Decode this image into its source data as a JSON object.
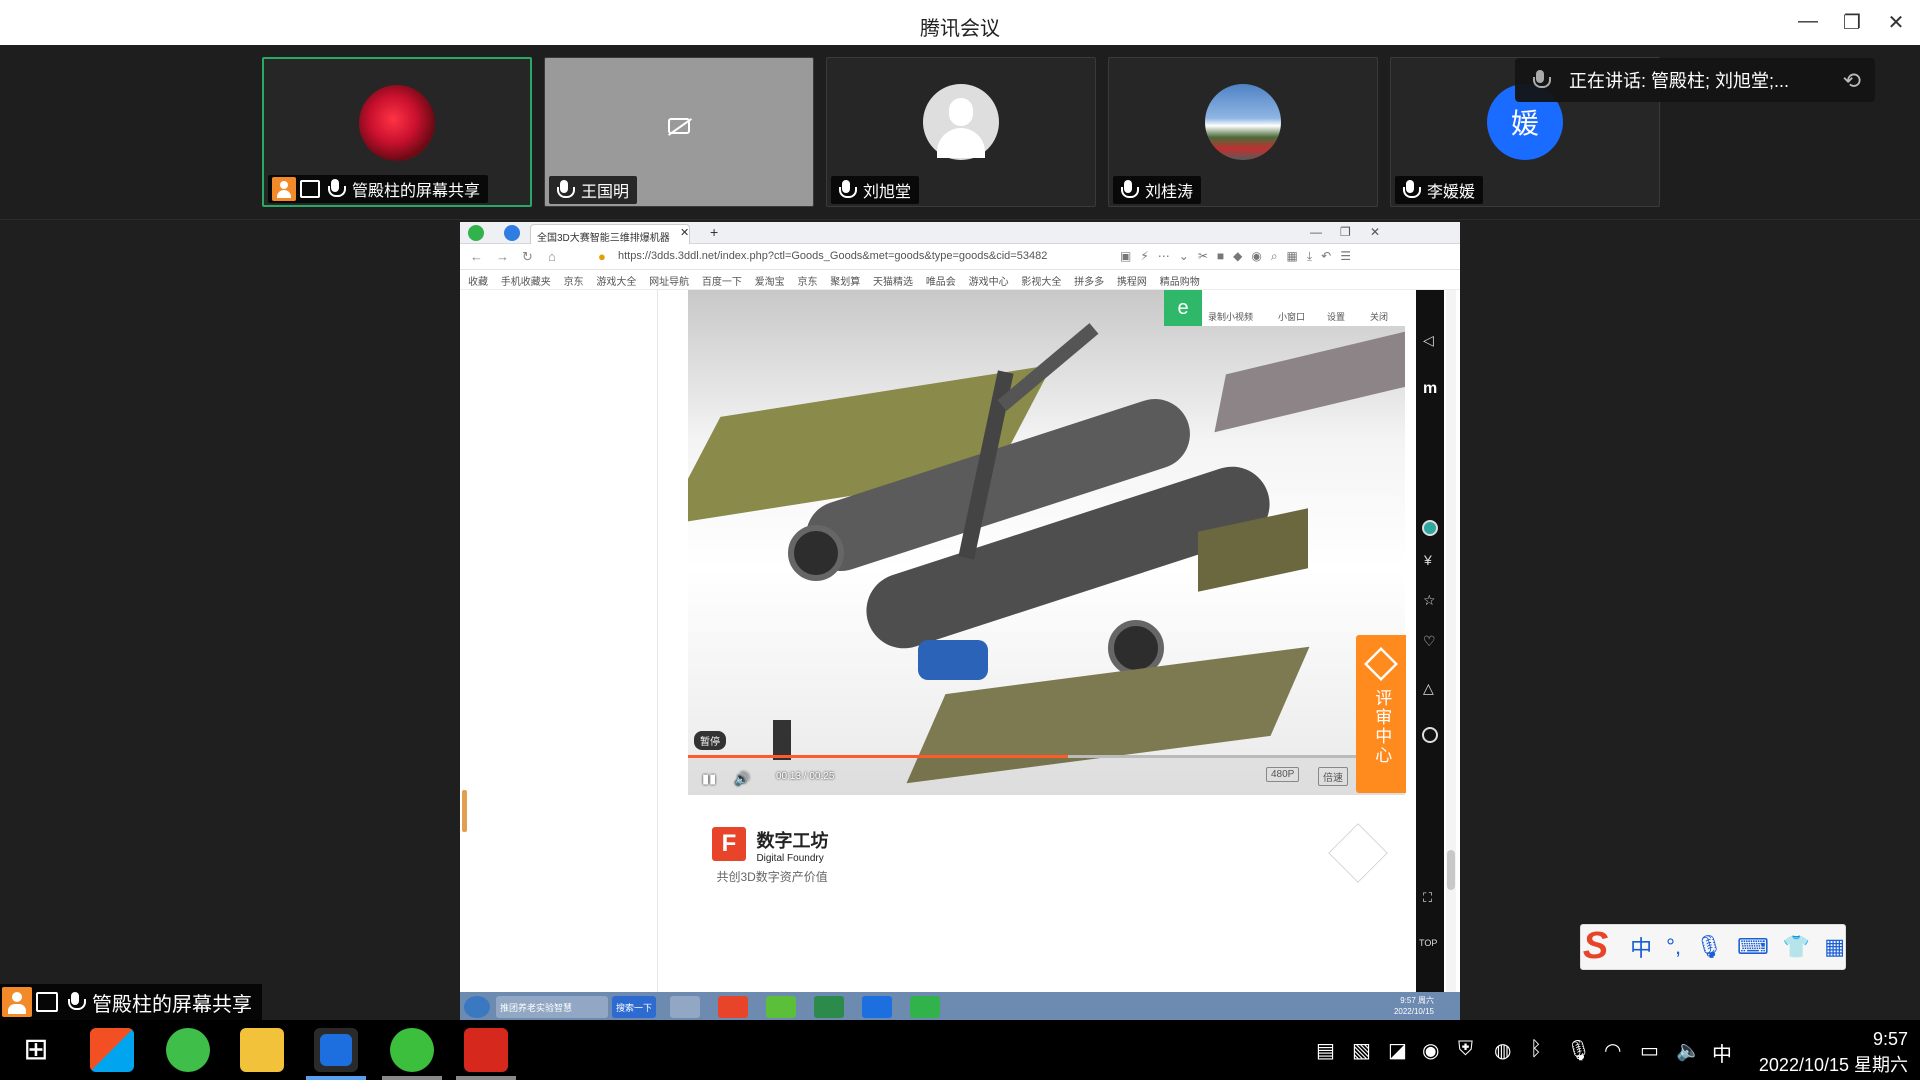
{
  "app": {
    "title": "腾讯会议"
  },
  "participants": [
    {
      "name": "管殿柱的屏幕共享",
      "active": true
    },
    {
      "name": "王国明",
      "camera_off": true
    },
    {
      "name": "刘旭堂"
    },
    {
      "name": "刘桂涛"
    },
    {
      "name": "李媛媛",
      "avatar_letter": "媛"
    }
  ],
  "speaking_banner": {
    "text": "正在讲话: 管殿柱; 刘旭堂;..."
  },
  "browser": {
    "tab_title": "全国3D大赛智能三维排爆机器",
    "url": "https://3dds.3ddl.net/index.php?ctl=Goods_Goods&met=goods&type=goods&cid=53482",
    "bookmarks": [
      "收藏",
      "手机收藏夹",
      "京东",
      "游戏大全",
      "网址导航",
      "百度一下",
      "爱淘宝",
      "京东",
      "聚划算",
      "天猫精选",
      "唯品会",
      "游戏中心",
      "影视大全",
      "拼多多",
      "携程网",
      "精品购物"
    ]
  },
  "video": {
    "toolbar": {
      "record": "录制小视频",
      "mini": "小窗口",
      "settings": "设置",
      "close": "关闭"
    },
    "pause_tip": "暂停",
    "time": "00:13 / 00:25",
    "progress": 0.53,
    "quality": "480P",
    "speed": "倍速"
  },
  "review_center": {
    "label": "评审中心"
  },
  "brand": {
    "logo_letter": "F",
    "name_cn": "数字工坊",
    "name_en": "Digital Foundry",
    "slogan": "共创3D数字资产价值"
  },
  "inner_taskbar": {
    "item1": "推团养老实验智慧",
    "item2": "搜索一下",
    "time": "9:57 周六",
    "date": "2022/10/15"
  },
  "sidebar_labels": {
    "top": "TOP"
  },
  "screen_share_badge": {
    "name": "管殿柱的屏幕共享"
  },
  "ime": {
    "lang": "中",
    "punct": "°,"
  },
  "taskbar": {
    "ime_indicator": "中",
    "time": "9:57",
    "date": "2022/10/15 星期六"
  },
  "colors": {
    "accent_green": "#2aa665",
    "review_orange": "#ff8a1e",
    "progress_red": "#ff5a2a"
  }
}
